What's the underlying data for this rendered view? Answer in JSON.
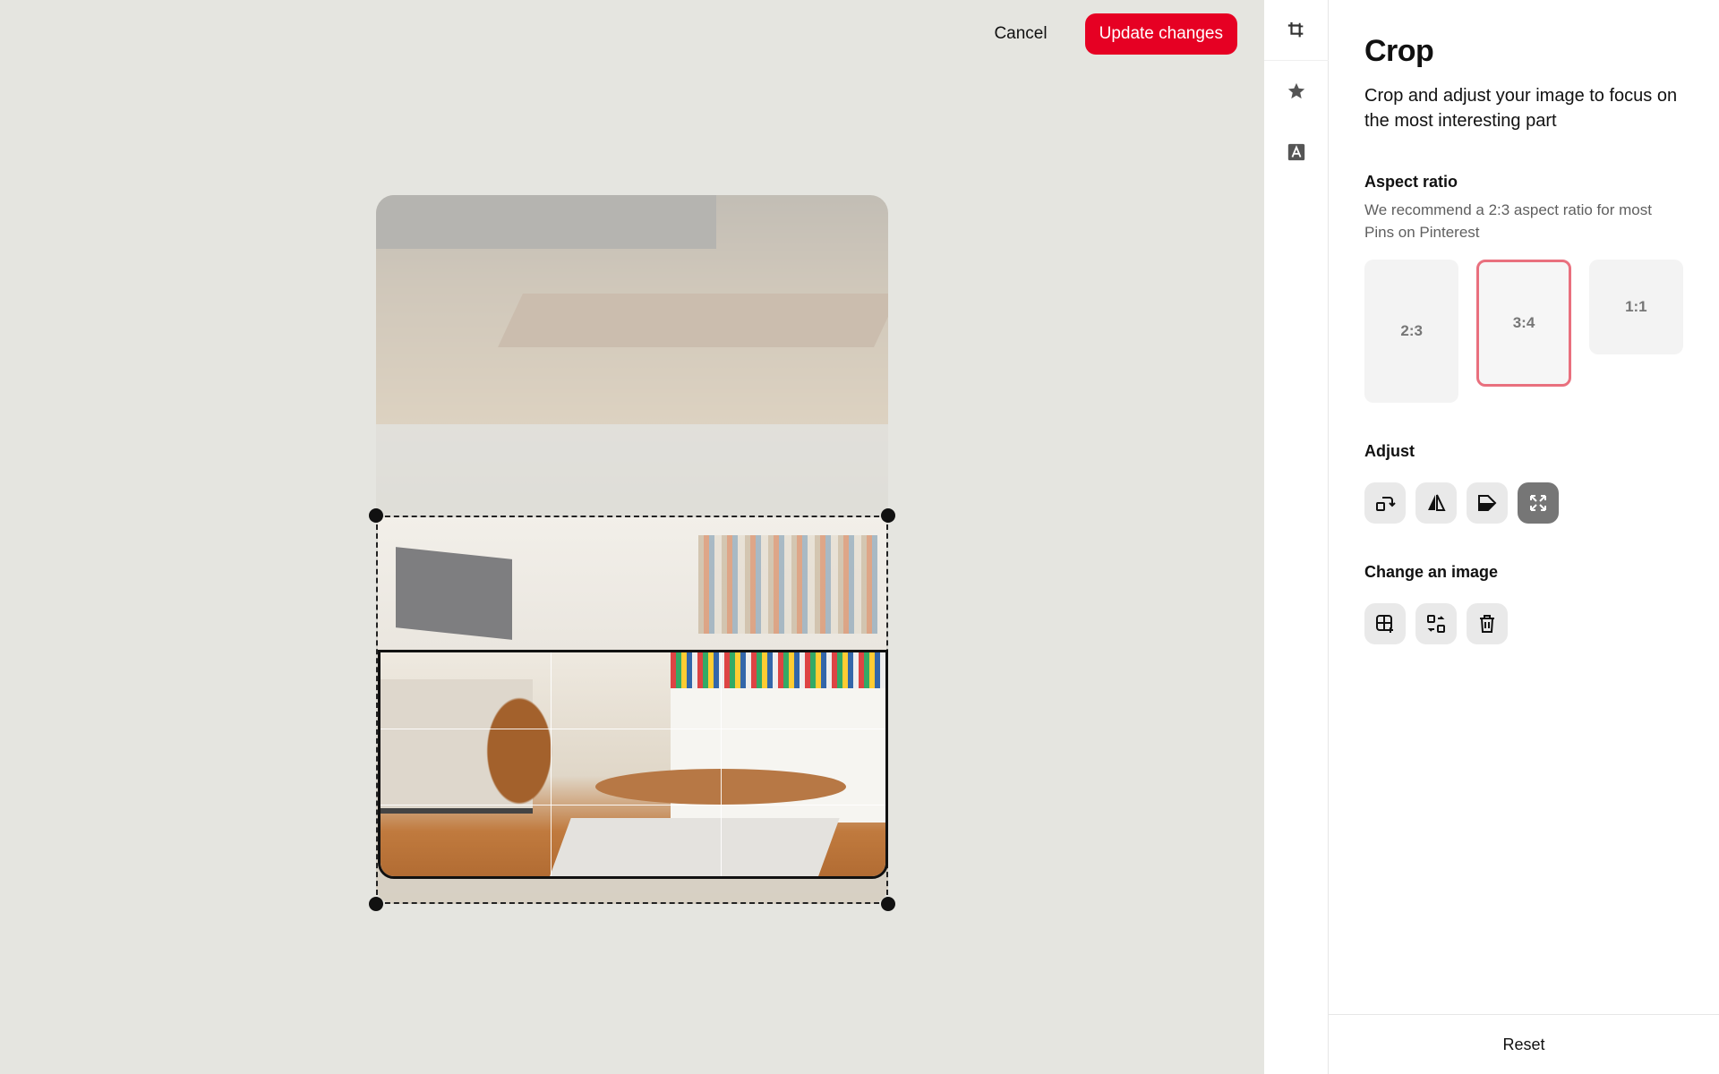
{
  "top_actions": {
    "cancel_label": "Cancel",
    "update_label": "Update changes"
  },
  "rail": {
    "items": [
      "crop-icon",
      "star-icon",
      "text-icon"
    ]
  },
  "panel": {
    "title": "Crop",
    "description": "Crop and adjust your image to focus on the most interesting part",
    "aspect_ratio": {
      "title": "Aspect ratio",
      "subtitle": "We recommend a 2:3 aspect ratio for most Pins on Pinterest",
      "options": [
        {
          "label": "2:3",
          "selected": false
        },
        {
          "label": "3:4",
          "selected": true
        },
        {
          "label": "1:1",
          "selected": false
        }
      ]
    },
    "adjust": {
      "title": "Adjust",
      "tools": [
        "rotate-icon",
        "flip-icon",
        "mirror-icon",
        "fit-icon"
      ],
      "active_tool": "fit-icon"
    },
    "change_image": {
      "title": "Change an image",
      "tools": [
        "add-image-icon",
        "replace-image-icon",
        "trash-icon"
      ]
    },
    "reset_label": "Reset"
  },
  "colors": {
    "accent": "#e60023",
    "selected_border": "#e9707e",
    "canvas_bg": "#e5e5e0"
  }
}
